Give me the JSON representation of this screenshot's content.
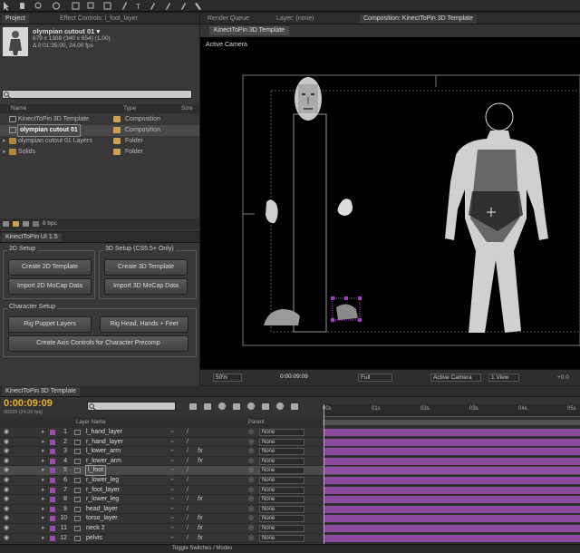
{
  "project_panel": {
    "tabs": [
      "Project",
      "Effect Controls: l_foot_layer"
    ],
    "item_name": "olympian cutout 01 ▾",
    "item_dims": "679 x 1308  (340 x 654) (1.00)",
    "item_duration": "Δ 0:01:35:00, 24.00 fps",
    "col_name": "Name",
    "col_type": "Type",
    "col_size": "Size",
    "items": [
      {
        "name": "KinectToPin 3D Template",
        "type": "Composition",
        "icon_color": "#8a8a8a",
        "type_color": "#c9a24a"
      },
      {
        "name": "olympian cutout 01",
        "type": "Composition",
        "icon_color": "#8a8a8a",
        "type_color": "#c9a24a",
        "selected": true
      },
      {
        "name": "olympian cutout 01 Layers",
        "type": "Folder",
        "icon_color": "#c9a24a",
        "type_color": "#c9a24a"
      },
      {
        "name": "Solids",
        "type": "Folder",
        "icon_color": "#c9a24a",
        "type_color": "#c9a24a"
      }
    ],
    "bpc": "8 bpc"
  },
  "ktp_panel": {
    "tab": "KinectToPin UI 1.5",
    "setup2d_label": "2D Setup",
    "setup3d_label": "3D Setup (CS5.5+ Only)",
    "btn_create2d": "Create 2D Template",
    "btn_import2d": "Import 2D MoCap Data",
    "btn_create3d": "Create 3D Template",
    "btn_import3d": "Import 3D MoCap Data",
    "char_label": "Character Setup",
    "btn_rig_puppet": "Rig Puppet Layers",
    "btn_rig_head": "Rig Head, Hands + Feet",
    "btn_axis": "Create Axis Controls for Character Precomp"
  },
  "comp_panel": {
    "tabs": [
      "Render Queue",
      "Layer: (none)",
      "Composition: KinectToPin 3D Template"
    ],
    "comp_tab": "KinectToPin 3D Template",
    "view_label": "Active Camera",
    "footer": {
      "zoom": "50%",
      "time": "0:00:09:09",
      "resolution": "Full",
      "camera": "Active Camera",
      "views": "1 View",
      "offset": "+0.0"
    }
  },
  "timeline": {
    "tab": "KinectToPin 3D Template",
    "time": "0:00:09:09",
    "frames": "00225 (24.00 fps)",
    "col_layer": "Layer Name",
    "col_parent": "Parent",
    "ruler": [
      "00s",
      "01s",
      "02s",
      "03s",
      "04s",
      "05s"
    ],
    "layers": [
      {
        "num": "1",
        "name": "l_hand_layer",
        "color": "#9a4fb0",
        "fx": false
      },
      {
        "num": "2",
        "name": "r_hand_layer",
        "color": "#9a4fb0",
        "fx": false
      },
      {
        "num": "3",
        "name": "l_lower_arm",
        "color": "#9a4fb0",
        "fx": true
      },
      {
        "num": "4",
        "name": "r_lower_arm",
        "color": "#9a4fb0",
        "fx": true
      },
      {
        "num": "5",
        "name": "l_foot",
        "color": "#9a4fb0",
        "fx": false,
        "selected": true
      },
      {
        "num": "6",
        "name": "r_lower_leg",
        "color": "#9a4fb0",
        "fx": false
      },
      {
        "num": "7",
        "name": "r_foot_layer",
        "color": "#9a4fb0",
        "fx": false
      },
      {
        "num": "8",
        "name": "r_lower_leg",
        "color": "#9a4fb0",
        "fx": true
      },
      {
        "num": "9",
        "name": "head_layer",
        "color": "#9a4fb0",
        "fx": false
      },
      {
        "num": "10",
        "name": "torso_layer",
        "color": "#9a4fb0",
        "fx": true
      },
      {
        "num": "11",
        "name": "neck 2",
        "color": "#9a4fb0",
        "fx": true
      },
      {
        "num": "12",
        "name": "pelvis",
        "color": "#9a4fb0",
        "fx": true
      }
    ],
    "parent_value": "None",
    "footer": "Toggle Switches / Modes"
  }
}
